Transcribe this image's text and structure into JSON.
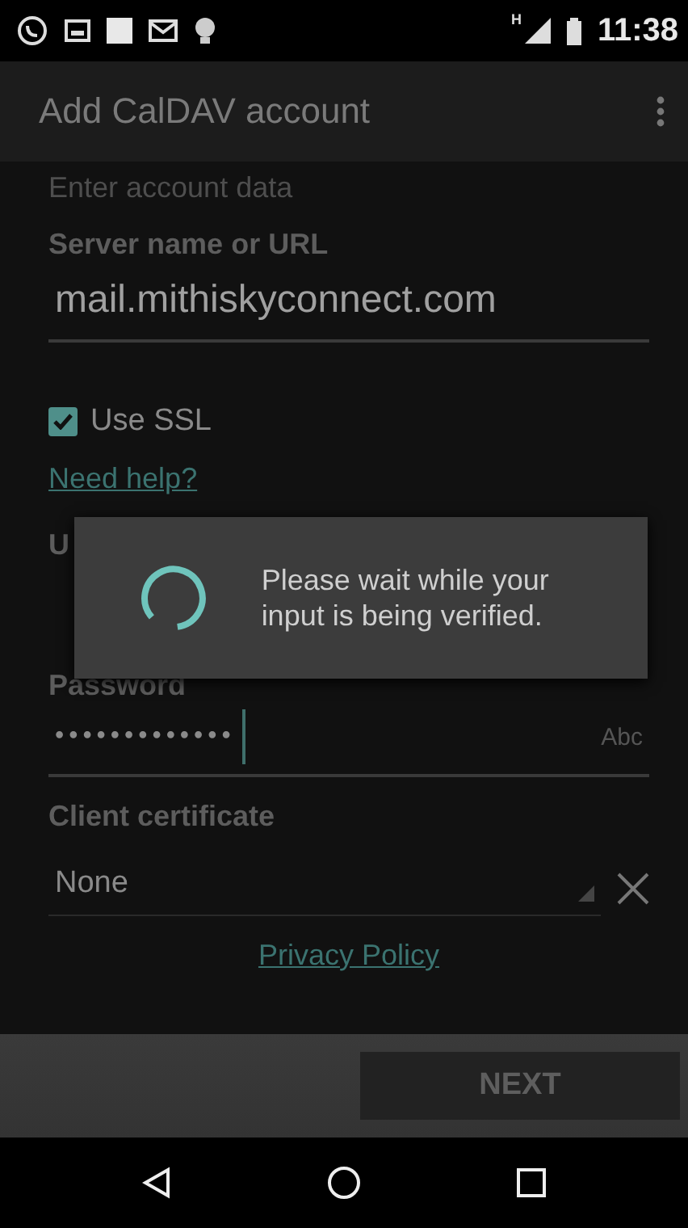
{
  "status_bar": {
    "time": "11:38",
    "network": "H"
  },
  "app_bar": {
    "title": "Add CalDAV account"
  },
  "form": {
    "section": "Enter account data",
    "server_label": "Server name or URL",
    "server_value": "mail.mithiskyconnect.com",
    "use_ssl": {
      "label": "Use SSL",
      "checked": true
    },
    "help_link": "Need help?",
    "username_label": "U",
    "password_label": "Password",
    "password_dots": "•••••••••••••",
    "password_hint": "Abc",
    "certificate_label": "Client certificate",
    "certificate_value": "None",
    "privacy_link": "Privacy Policy"
  },
  "dialog": {
    "message": "Please wait while your input is being verified."
  },
  "bottom_bar": {
    "next_button": "NEXT",
    "next_disabled": true
  }
}
